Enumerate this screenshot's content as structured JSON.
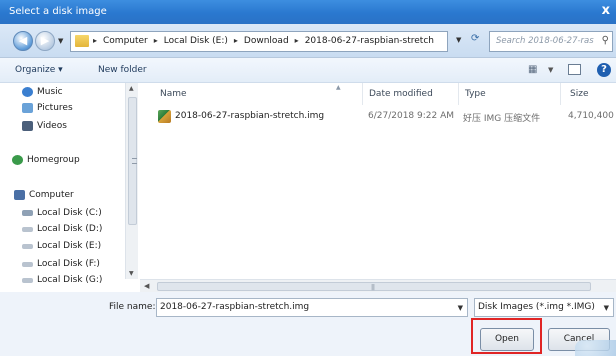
{
  "window": {
    "title": "Select a disk image",
    "close_glyph": "x"
  },
  "address": {
    "crumbs": [
      "Computer",
      "Local Disk (E:)",
      "Download",
      "2018-06-27-raspbian-stretch"
    ],
    "separator": "▸",
    "search_placeholder": "Search 2018-06-27-ras..."
  },
  "toolbar": {
    "organize_label": "Organize ▾",
    "new_folder_label": "New folder",
    "help_glyph": "?"
  },
  "nav": {
    "items": [
      {
        "label": "Music",
        "icon": "music-icon",
        "color": "#3b7fd0"
      },
      {
        "label": "Pictures",
        "icon": "pictures-icon",
        "color": "#6aa2d8"
      },
      {
        "label": "Videos",
        "icon": "videos-icon",
        "color": "#4b5f7a"
      },
      {
        "label": "Homegroup",
        "icon": "homegroup-icon",
        "color": "#3a9a4a"
      },
      {
        "label": "Computer",
        "icon": "computer-icon",
        "color": "#4a6fa5"
      },
      {
        "label": "Local Disk (C:)",
        "icon": "system-drive-icon",
        "color": "#8fa1b5"
      },
      {
        "label": "Local Disk (D:)",
        "icon": "drive-icon",
        "color": "#b9c3cf"
      },
      {
        "label": "Local Disk (E:)",
        "icon": "drive-icon",
        "color": "#b9c3cf"
      },
      {
        "label": "Local Disk (F:)",
        "icon": "drive-icon",
        "color": "#b9c3cf"
      },
      {
        "label": "Local Disk (G:)",
        "icon": "drive-icon",
        "color": "#b9c3cf"
      }
    ]
  },
  "columns": {
    "name": "Name",
    "date": "Date modified",
    "type": "Type",
    "size": "Size"
  },
  "files": [
    {
      "name": "2018-06-27-raspbian-stretch.img",
      "date": "6/27/2018 9:22 AM",
      "type": "好压 IMG 压缩文件",
      "size": "4,710,400 ..."
    }
  ],
  "bottom": {
    "file_name_label": "File name:",
    "file_name_value": "2018-06-27-raspbian-stretch.img",
    "filter_value": "Disk Images (*.img *.IMG)",
    "open_label": "Open",
    "cancel_label": "Cancel"
  },
  "colors": {
    "titlebar": "#2a78cf",
    "highlight": "#e02525"
  }
}
